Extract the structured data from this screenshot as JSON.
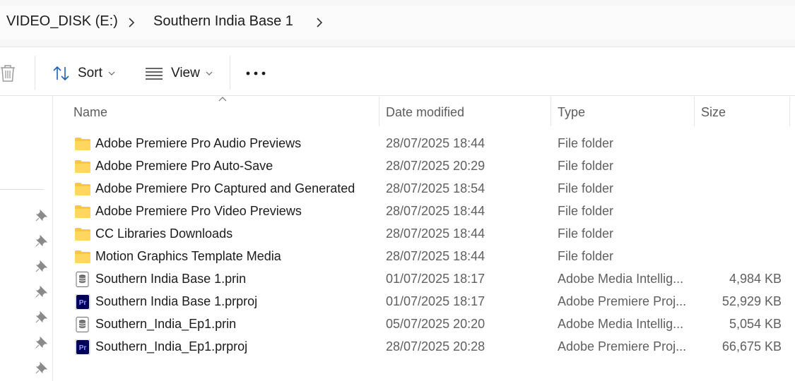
{
  "breadcrumb": {
    "items": [
      "VIDEO_DISK (E:)",
      "Southern India Base 1"
    ]
  },
  "toolbar": {
    "sort_label": "Sort",
    "view_label": "View",
    "more_icon": "more-horizontal-icon",
    "delete_icon": "trash-icon"
  },
  "columns": {
    "name": "Name",
    "date": "Date modified",
    "type": "Type",
    "size": "Size"
  },
  "files": [
    {
      "name": "Adobe Premiere Pro Audio Previews",
      "date": "28/07/2025 18:44",
      "type": "File folder",
      "size": "",
      "icon": "folder-icon"
    },
    {
      "name": "Adobe Premiere Pro Auto-Save",
      "date": "28/07/2025 20:29",
      "type": "File folder",
      "size": "",
      "icon": "folder-icon"
    },
    {
      "name": "Adobe Premiere Pro Captured and Generated",
      "date": "28/07/2025 18:54",
      "type": "File folder",
      "size": "",
      "icon": "folder-icon"
    },
    {
      "name": "Adobe Premiere Pro Video Previews",
      "date": "28/07/2025 18:44",
      "type": "File folder",
      "size": "",
      "icon": "folder-icon"
    },
    {
      "name": "CC Libraries Downloads",
      "date": "28/07/2025 18:44",
      "type": "File folder",
      "size": "",
      "icon": "folder-icon"
    },
    {
      "name": "Motion Graphics Template Media",
      "date": "28/07/2025 18:44",
      "type": "File folder",
      "size": "",
      "icon": "folder-icon"
    },
    {
      "name": "Southern India Base 1.prin",
      "date": "01/07/2025 18:17",
      "type": "Adobe Media Intellig...",
      "size": "4,984 KB",
      "icon": "database-file-icon"
    },
    {
      "name": "Southern India Base 1.prproj",
      "date": "01/07/2025 18:17",
      "type": "Adobe Premiere Proj...",
      "size": "52,929 KB",
      "icon": "premiere-project-icon"
    },
    {
      "name": "Southern_India_Ep1.prin",
      "date": "05/07/2025 20:20",
      "type": "Adobe Media Intellig...",
      "size": "5,054 KB",
      "icon": "database-file-icon"
    },
    {
      "name": "Southern_India_Ep1.prproj",
      "date": "28/07/2025 20:28",
      "type": "Adobe Premiere Proj...",
      "size": "66,675 KB",
      "icon": "premiere-project-icon"
    }
  ],
  "colors": {
    "folder": "#f8c93f",
    "premiere_bg": "#00005b",
    "premiere_text": "#9999ff"
  }
}
